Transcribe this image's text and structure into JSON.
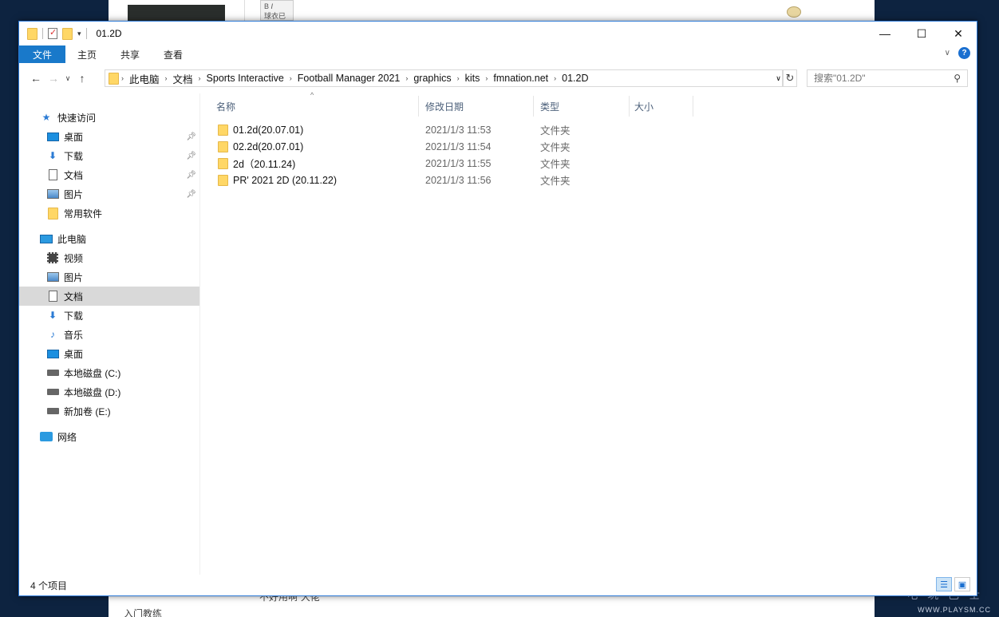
{
  "background": {
    "widget_text": "球衣已经",
    "bottom_left_text": "入门教练",
    "bottom_text": "不好用啊 大佬",
    "watermark_cn": "电 玩 巴 士",
    "watermark_en": "WWW.PLAYSM.CC"
  },
  "window": {
    "title": "01.2D",
    "controls": {
      "minimize": "—",
      "maximize": "☐",
      "close": "✕"
    }
  },
  "ribbon": {
    "tabs": [
      "文件",
      "主页",
      "共享",
      "查看"
    ]
  },
  "nav": {
    "back": "←",
    "forward": "→",
    "recent": "∨",
    "up": "↑"
  },
  "address": {
    "crumbs": [
      "此电脑",
      "文档",
      "Sports Interactive",
      "Football Manager 2021",
      "graphics",
      "kits",
      "fmnation.net",
      "01.2D"
    ],
    "refresh": "↻"
  },
  "search": {
    "placeholder": "搜索\"01.2D\""
  },
  "sidebar": {
    "quick_access": "快速访问",
    "quick_items": [
      {
        "label": "桌面",
        "pinned": true
      },
      {
        "label": "下载",
        "pinned": true
      },
      {
        "label": "文档",
        "pinned": true
      },
      {
        "label": "图片",
        "pinned": true
      },
      {
        "label": "常用软件",
        "pinned": false
      }
    ],
    "this_pc": "此电脑",
    "pc_items": [
      "视频",
      "图片",
      "文档",
      "下载",
      "音乐",
      "桌面",
      "本地磁盘 (C:)",
      "本地磁盘 (D:)",
      "新加卷 (E:)"
    ],
    "network": "网络",
    "selected": "文档"
  },
  "columns": {
    "name": "名称",
    "date": "修改日期",
    "type": "类型",
    "size": "大小"
  },
  "files": [
    {
      "name": "01.2d(20.07.01)",
      "date": "2021/1/3 11:53",
      "type": "文件夹"
    },
    {
      "name": "02.2d(20.07.01)",
      "date": "2021/1/3 11:54",
      "type": "文件夹"
    },
    {
      "name": "2d（20.11.24)",
      "date": "2021/1/3 11:55",
      "type": "文件夹"
    },
    {
      "name": "PR' 2021 2D (20.11.22)",
      "date": "2021/1/3 11:56",
      "type": "文件夹"
    }
  ],
  "status": {
    "count": "4 个项目"
  }
}
